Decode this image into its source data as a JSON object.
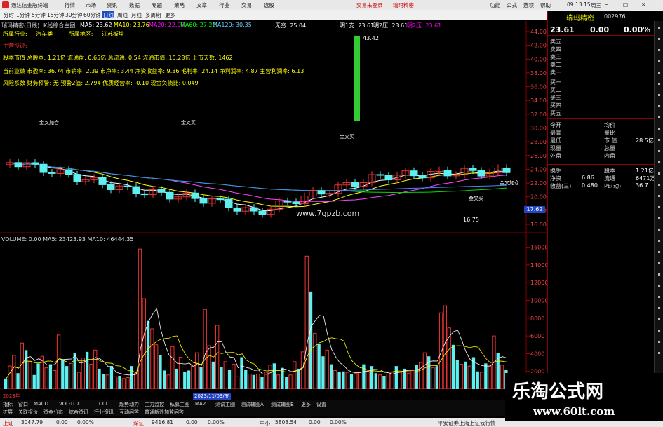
{
  "titlebar": {
    "app_name": "通达信金融终端",
    "menus": [
      "行情",
      "市场",
      "资讯",
      "数据",
      "专题",
      "策略",
      "文章",
      "行业",
      "交易",
      "选股"
    ],
    "alert": "交易未登录",
    "alert2": "瑞玛精密",
    "right_menus": [
      "功能",
      "公式",
      "选项",
      "帮助"
    ],
    "time": "09:13:15",
    "weekday": "周三"
  },
  "periodbar": {
    "periods": [
      "分时",
      "1分钟",
      "5分钟",
      "15分钟",
      "30分钟",
      "60分钟",
      "日线",
      "周线",
      "月线",
      "多周期",
      "更多"
    ],
    "active": "日线"
  },
  "main_header": {
    "stock": "瑞玛精密(日线)",
    "indicator": "K线综合主图",
    "ma5": "MA5: 23.62",
    "ma10": "MA10: 23.76",
    "ma20": "MA20: 22.06",
    "ma60": "MA60: 27.20",
    "ma120": "MA120: 30.35",
    "wr": "无穷: 25.04",
    "next1": "明1支: 23.61",
    "next2": "明2压: 23.61",
    "next3": "明2压: 23.61"
  },
  "info_lines": {
    "industry_label": "所属行业:",
    "industry_val": "汽车类",
    "region_label": "所属地区:",
    "region_val": "江苏板块",
    "main_biz": "主营投评:",
    "line1": "股本市值  总股本: 1.21亿 流通盘: 0.65亿 总流通: 0.54 流通市值: 15.28亿 上市天数: 1462",
    "line2": "当前业绩  市盈率: 36.74 市销率: 2.39 市净率: 3.44 净资收益率: 9.36 毛利率: 24.14 净利润率: 4.87 主营利润率: 6.13",
    "line3": "风险系数  财务预警: 无  预警2值: 2.794 优质经营率: -0.10 现金负债比: 0.049"
  },
  "chart_labels": {
    "watermark_site": "www.7gpzb.com",
    "high_label": "43.42",
    "low_label": "16.75",
    "last_price_tag": "17.62",
    "volume_header": "VOLUME: 0.00  MA5: 23423.93  MA10: 46444.35",
    "date_tag": "2023/11/03/五",
    "year_label": "2023年",
    "golden_cross": "金叉加仓",
    "cross_buy": "金叉买",
    "buy": "买",
    "sell": "卖"
  },
  "price_axis": [
    "44.00",
    "42.00",
    "40.00",
    "38.00",
    "36.00",
    "34.00",
    "32.00",
    "30.00",
    "28.00",
    "26.00",
    "24.00",
    "22.00",
    "20.00",
    "18.00",
    "16.00"
  ],
  "volume_axis": [
    "16000",
    "14000",
    "12000",
    "10000",
    "8000",
    "6000",
    "4000",
    "2000"
  ],
  "chart_data": {
    "type": "bar",
    "title": "VOLUME",
    "ylim": [
      0,
      17000
    ],
    "series": [
      {
        "name": "VOLUME",
        "values": [
          1200,
          2600,
          3800,
          1800,
          5200,
          4400,
          3100,
          1600,
          2900,
          3700,
          2400,
          2800,
          2100,
          6100,
          3300,
          2600,
          2900,
          4100,
          1900,
          3500,
          4200,
          2800,
          4400,
          2300,
          1700,
          1600,
          2600,
          1400,
          1500,
          1200,
          1300,
          2600,
          1800,
          15800,
          10200,
          7700,
          6800,
          5000,
          3800,
          2100,
          1600,
          4800,
          2300,
          3600,
          1900,
          2100,
          2700,
          4100,
          2500,
          9000,
          4900,
          3100,
          7200,
          2500,
          3100,
          2200,
          2800,
          1400,
          3600,
          2200,
          1700,
          1600,
          1700,
          1400,
          1900,
          2700,
          2900,
          1600,
          2400,
          1400,
          1600,
          3100,
          2300,
          4200,
          15000,
          11000,
          6300,
          5100,
          3700,
          4400,
          2800,
          2100,
          1900,
          2000,
          1900,
          1700,
          1800,
          1900,
          2800,
          2000,
          2600,
          1800,
          1600,
          1500,
          1700,
          1900,
          2600,
          1900,
          2300,
          1800,
          2100,
          2700,
          3000,
          4100,
          3700,
          2400,
          2600,
          8600,
          9400,
          6900,
          5000,
          3300,
          2800,
          3100,
          2600,
          3600,
          2000,
          1900,
          2900,
          2600,
          6000,
          4100,
          2700,
          2200
        ]
      }
    ],
    "ma5_ma10_shown": true
  },
  "right_panel": {
    "header_name": "瑞玛精密",
    "code": "002976",
    "price": "23.61",
    "change": "0.00",
    "pct": "0.00%",
    "sell_labels": [
      "卖五",
      "卖四",
      "卖三",
      "卖二",
      "卖一"
    ],
    "buy_labels": [
      "买一",
      "买二",
      "买三",
      "买四",
      "买五"
    ],
    "quote": [
      [
        "今开",
        "",
        "均价",
        ""
      ],
      [
        "最高",
        "",
        "量比",
        ""
      ],
      [
        "最低",
        "",
        "市  值",
        "28.5亿"
      ],
      [
        "现量",
        "",
        "总量",
        ""
      ],
      [
        "外盘",
        "",
        "内盘",
        ""
      ]
    ],
    "fund": [
      [
        "换手",
        "",
        "股本",
        "1.21亿"
      ],
      [
        "净资",
        "6.86",
        "流通",
        "6471万"
      ],
      [
        "收益(三)",
        "0.480",
        "PE(动)",
        "36.7"
      ]
    ]
  },
  "tabs": [
    "指标",
    "窗口",
    "MACD",
    "VOL-TDX",
    "CCI",
    "趋势动力",
    "主力监控",
    "私募主图",
    "MA2",
    "测试主图",
    "测试辅图A",
    "测试辅图B",
    "更多",
    "设置"
  ],
  "tabs2": [
    "扩展",
    "关联报价",
    "资金分布",
    "综合资讯",
    "行业资讯",
    "互动问答",
    "普通新浪加监问答"
  ],
  "statusbar": {
    "index1_name": "上证",
    "index1_val": "3047.79",
    "index1_chg": "0.00",
    "index1_pct": "0.00%",
    "index2_name": "深证",
    "index2_val": "9416.81",
    "index2_chg": "0.00",
    "index2_pct": "0.00%",
    "index3_name": "中小",
    "index3_val": "5808.54",
    "index3_chg": "0.00",
    "index3_pct": "0.00%",
    "broker": "平安证券上海上证云行情"
  },
  "watermark": {
    "brand": "乐淘公式网",
    "url": "www.60lt.com"
  }
}
